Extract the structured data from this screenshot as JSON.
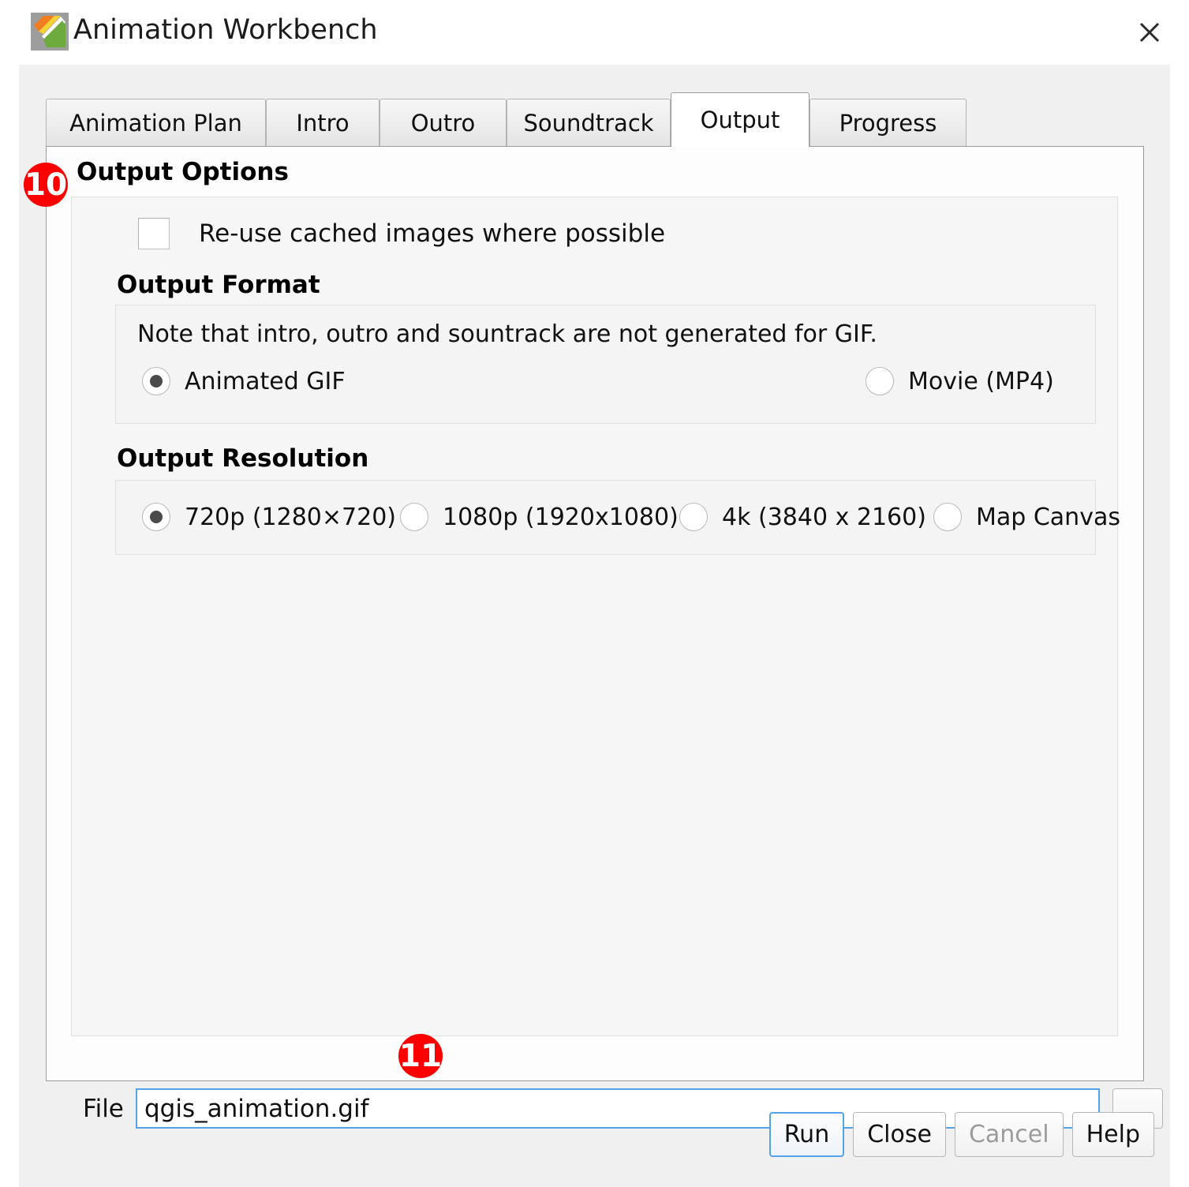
{
  "window": {
    "title": "Animation Workbench",
    "icon": "qgis-animation-workbench-logo",
    "close_label": "✕"
  },
  "tabs": [
    {
      "label": "Animation Plan",
      "active": false
    },
    {
      "label": "Intro",
      "active": false
    },
    {
      "label": "Outro",
      "active": false
    },
    {
      "label": "Soundtrack",
      "active": false
    },
    {
      "label": "Output",
      "active": true
    },
    {
      "label": "Progress",
      "active": false
    }
  ],
  "output_tab": {
    "section_title": "Output Options",
    "reuse_cache": {
      "label": "Re-use cached images where possible",
      "checked": false
    },
    "output_format": {
      "heading": "Output Format",
      "note": "Note that intro, outro and sountrack are not generated for GIF.",
      "options": [
        {
          "label": "Animated GIF",
          "checked": true
        },
        {
          "label": "Movie (MP4)",
          "checked": false
        }
      ]
    },
    "output_resolution": {
      "heading": "Output Resolution",
      "options": [
        {
          "label": "720p (1280×720)",
          "checked": true
        },
        {
          "label": "1080p (1920x1080)",
          "checked": false
        },
        {
          "label": "4k (3840 x 2160)",
          "checked": false
        },
        {
          "label": "Map Canvas",
          "checked": false
        }
      ]
    },
    "file": {
      "label": "File",
      "value": "qgis_animation.gif",
      "placeholder": "",
      "browse_label": "..."
    }
  },
  "buttons": {
    "run": "Run",
    "close": "Close",
    "cancel": "Cancel",
    "help": "Help"
  },
  "annotations": [
    {
      "id": "10",
      "text": "10"
    },
    {
      "id": "11",
      "text": "11"
    }
  ],
  "colors": {
    "badge": "#fb0000",
    "focus": "#53a3ea",
    "dialog_bg": "#f0f0f0",
    "panel_bg": "#fdfdfd"
  }
}
